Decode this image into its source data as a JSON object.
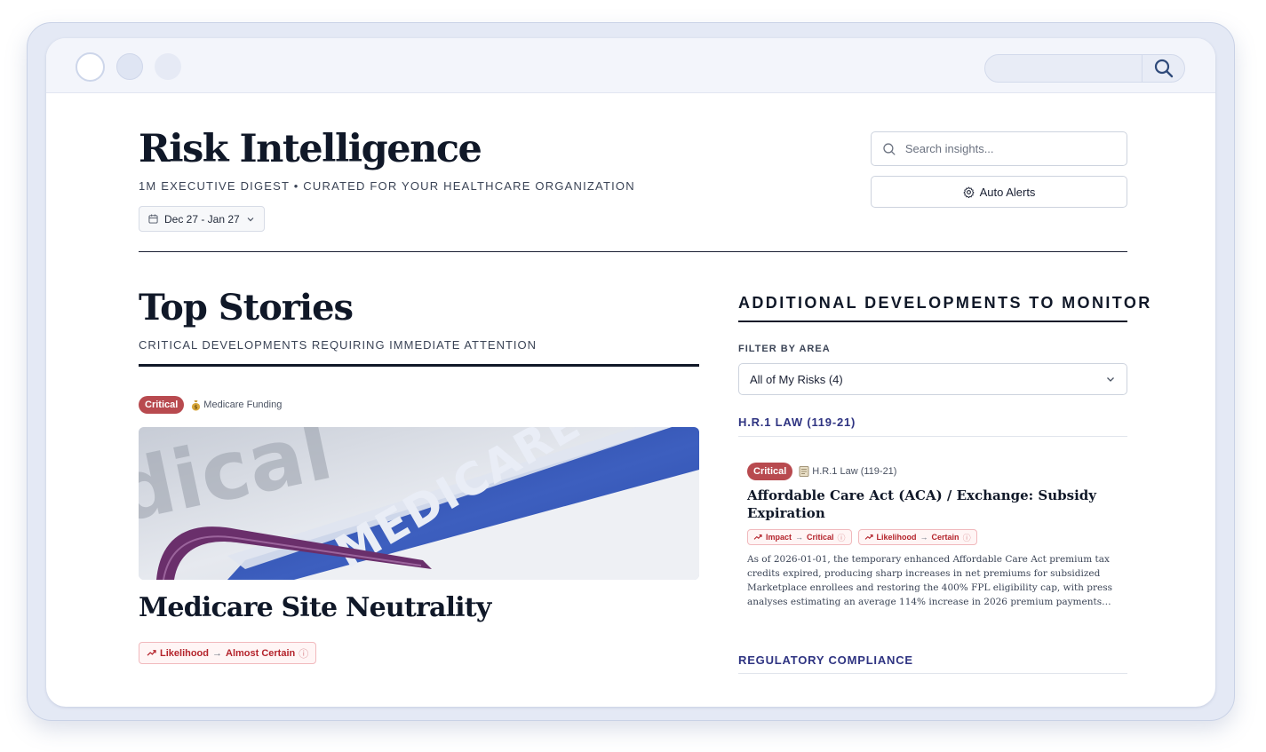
{
  "header": {
    "title": "Risk Intelligence",
    "subtitle": "1M EXECUTIVE DIGEST • CURATED FOR YOUR HEALTHCARE ORGANIZATION",
    "date_range": "Dec 27 - Jan 27",
    "search_placeholder": "Search insights...",
    "alerts_label": "Auto Alerts"
  },
  "top_stories": {
    "title": "Top Stories",
    "subtitle": "CRITICAL DEVELOPMENTS REQUIRING IMMEDIATE ATTENTION",
    "story": {
      "severity": "Critical",
      "category_icon": "money-bag-icon",
      "category": "Medicare Funding",
      "image_text": "MEDICARE",
      "headline": "Medicare Site Neutrality",
      "pill": {
        "label": "Likelihood",
        "value": "Almost Certain"
      }
    }
  },
  "developments": {
    "title": "ADDITIONAL DEVELOPMENTS TO MONITOR",
    "filter_label": "FILTER BY AREA",
    "filter_value": "All of My Risks (4)",
    "sections": [
      {
        "heading": "H.R.1 LAW (119-21)",
        "card": {
          "severity": "Critical",
          "category_icon": "ledger-icon",
          "category": "H.R.1 Law (119-21)",
          "title": "Affordable Care Act (ACA) / Exchange: Subsidy Expiration",
          "pills": [
            {
              "label": "Impact",
              "value": "Critical"
            },
            {
              "label": "Likelihood",
              "value": "Certain"
            }
          ],
          "body": "As of 2026-01-01, the temporary enhanced Affordable Care Act premium tax credits expired, producing sharp increases in net premiums for subsidized Marketplace enrollees and restoring the 400% FPL eligibility cap, with press analyses estimating an average 114% increase in 2026 premium payments and more than four million people projected to lose coverage."
        }
      },
      {
        "heading": "REGULATORY COMPLIANCE"
      }
    ]
  },
  "colors": {
    "critical": "#b84a4f",
    "pill_text": "#b4242c",
    "section_heading": "#2f3482"
  }
}
